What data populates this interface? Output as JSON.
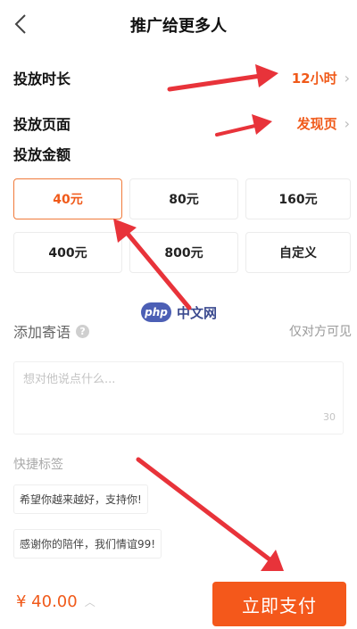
{
  "header": {
    "title": "推广给更多人"
  },
  "duration": {
    "label": "投放时长",
    "value": "12小时"
  },
  "page": {
    "label": "投放页面",
    "value": "发现页"
  },
  "amount": {
    "label": "投放金额",
    "options": [
      "40元",
      "80元",
      "160元",
      "400元",
      "800元",
      "自定义"
    ],
    "selected": "40元"
  },
  "message": {
    "label": "添加寄语",
    "note": "仅对方可见",
    "placeholder": "想对他说点什么...",
    "count": "30"
  },
  "quick_tags": {
    "label": "快捷标签",
    "items": [
      "希望你越来越好，支持你!",
      "感谢你的陪伴，我们情谊99!"
    ]
  },
  "footer": {
    "price": "¥ 40.00",
    "pay_label": "立即支付"
  },
  "watermark": {
    "badge": "php",
    "text": "中文网"
  },
  "colors": {
    "accent": "#f4581b",
    "annotation_arrow": "#e8333a"
  }
}
